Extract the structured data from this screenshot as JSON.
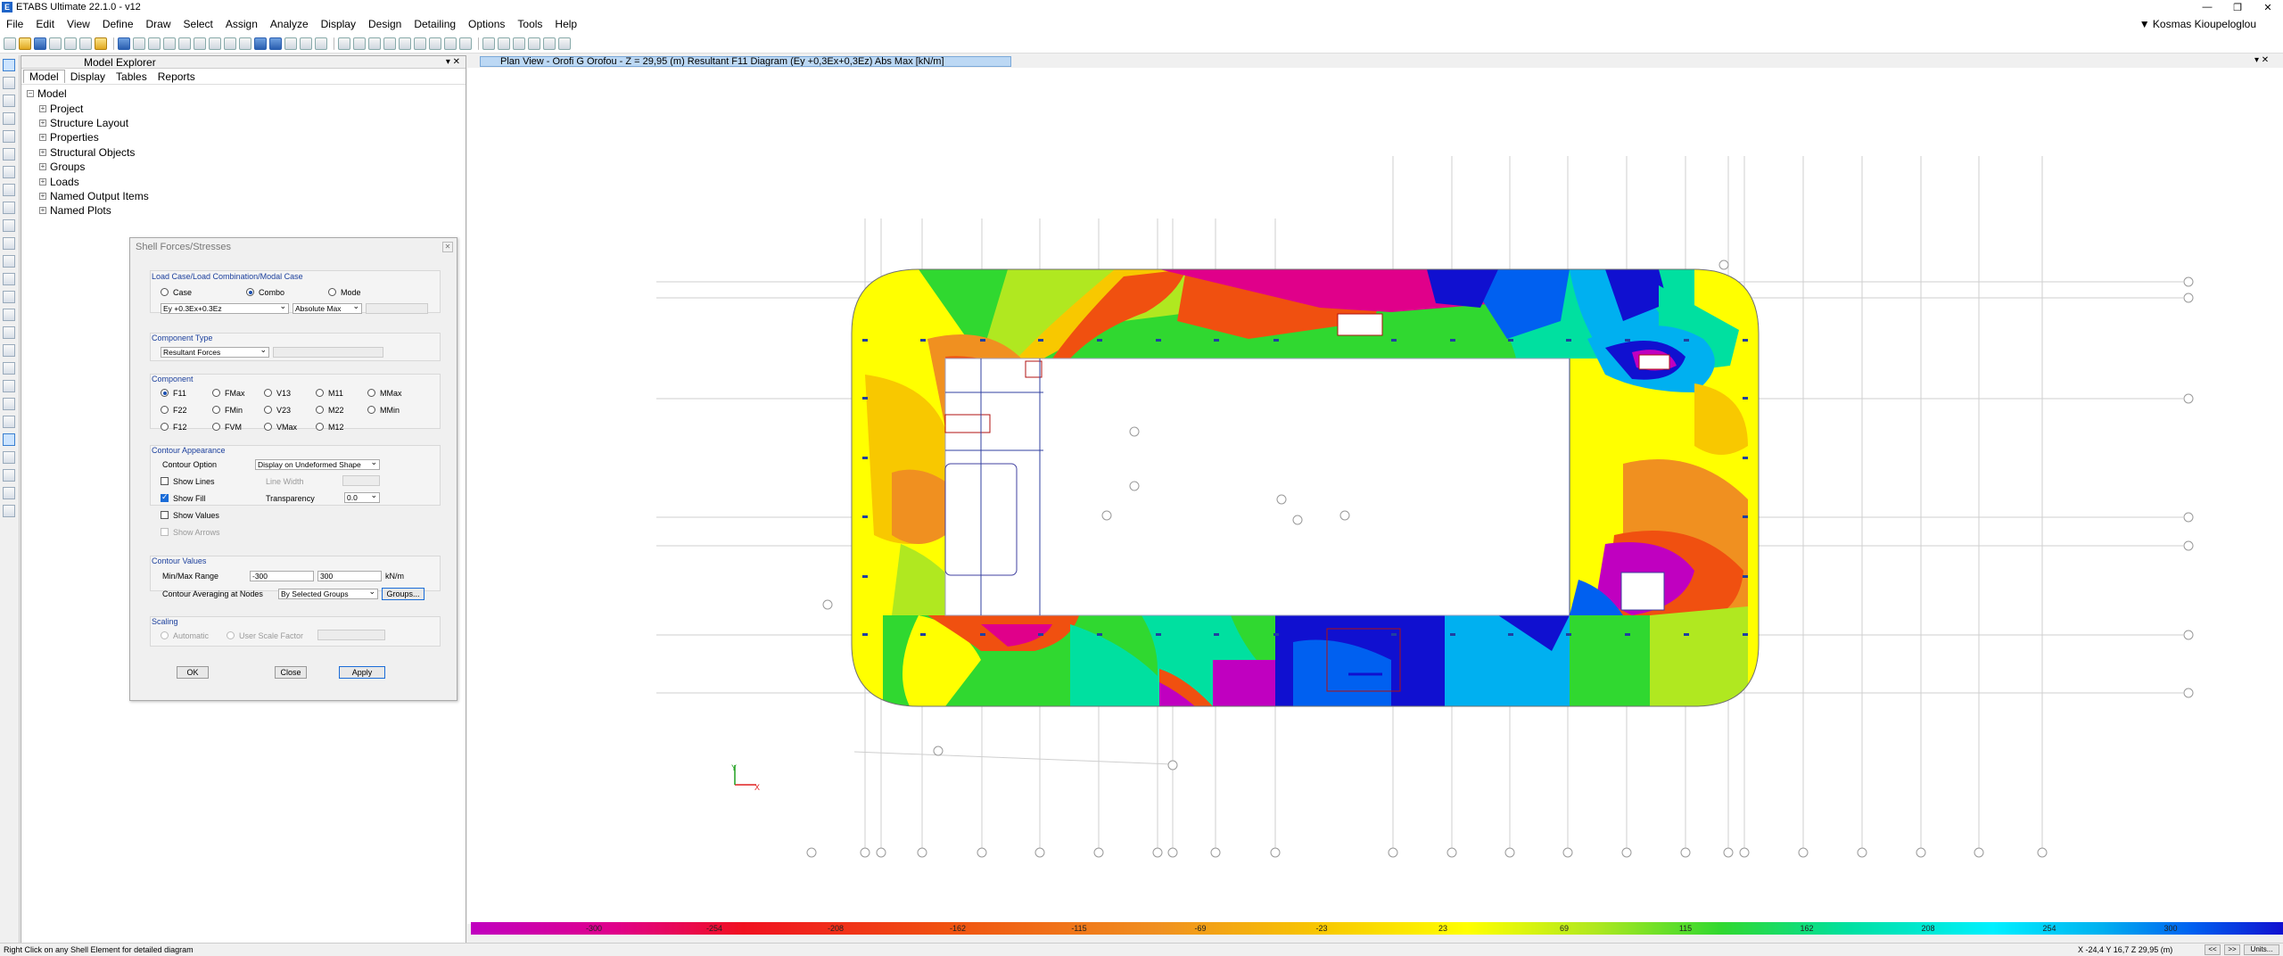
{
  "app": {
    "title": "ETABS Ultimate 22.1.0 - v12",
    "logo_letter": "E",
    "window_controls": [
      "—",
      "❐",
      "✕"
    ]
  },
  "menu": [
    "File",
    "Edit",
    "View",
    "Define",
    "Draw",
    "Select",
    "Assign",
    "Analyze",
    "Display",
    "Design",
    "Detailing",
    "Options",
    "Tools",
    "Help"
  ],
  "user": "▼  Kosmas Kioupeloglou",
  "explorer": {
    "title": "Model Explorer",
    "controls": "▾  ✕",
    "tabs": [
      "Model",
      "Display",
      "Tables",
      "Reports"
    ],
    "root": "Model",
    "items": [
      "Project",
      "Structure Layout",
      "Properties",
      "Structural Objects",
      "Groups",
      "Loads",
      "Named Output Items",
      "Named Plots"
    ]
  },
  "dialog": {
    "title": "Shell Forces/Stresses",
    "load_case_group": "Load Case/Load Combination/Modal Case",
    "case_label": "Case",
    "combo_label": "Combo",
    "mode_label": "Mode",
    "combo_value": "Ey +0.3Ex+0.3Ez",
    "envelope_value": "Absolute Max",
    "component_type_group": "Component Type",
    "component_type_value": "Resultant Forces",
    "component_group": "Component",
    "components": [
      "F11",
      "FMax",
      "V13",
      "M11",
      "MMax",
      "F22",
      "FMin",
      "V23",
      "M22",
      "MMin",
      "F12",
      "FVM",
      "VMax",
      "M12"
    ],
    "contour_appearance_group": "Contour Appearance",
    "contour_option_label": "Contour Option",
    "contour_option_value": "Display on Undeformed Shape",
    "show_lines": "Show Lines",
    "line_width": "Line Width",
    "show_fill": "Show Fill",
    "transparency_label": "Transparency",
    "transparency_value": "0.0",
    "show_values": "Show Values",
    "show_arrows": "Show Arrows",
    "contour_values_group": "Contour Values",
    "minmax_label": "Min/Max Range",
    "min_value": "-300",
    "max_value": "300",
    "units": "kN/m",
    "averaging_label": "Contour Averaging at Nodes",
    "averaging_value": "By Selected Groups",
    "groups_button": "Groups...",
    "scaling_group": "Scaling",
    "automatic": "Automatic",
    "user_scale": "User Scale Factor",
    "ok": "OK",
    "close": "Close",
    "apply": "Apply"
  },
  "view": {
    "tab_title": "Plan View - Orofi G Orofou - Z = 29,95 (m)   Resultant F11 Diagram   (Ey +0,3Ex+0,3Ez) Abs Max  [kN/m]",
    "controls": "▾  ✕",
    "axis_x": "X",
    "axis_y": "Y"
  },
  "legend": {
    "values": [
      "-300",
      "-254",
      "-208",
      "-162",
      "-115",
      "-69",
      "-23",
      "23",
      "69",
      "115",
      "162",
      "208",
      "254",
      "300"
    ],
    "colors": [
      "#c000c0",
      "#e0008a",
      "#f01020",
      "#f05010",
      "#f09020",
      "#f8c800",
      "#ffff00",
      "#b0e820",
      "#30d830",
      "#00e0a0",
      "#00f0ff",
      "#00b0f0",
      "#0060f0",
      "#1010d0"
    ]
  },
  "status": {
    "message": "Right Click on any Shell Element for detailed diagram",
    "coords": "X -24,4  Y 16,7  Z 29,95 (m)",
    "nav": [
      "<<",
      ">>"
    ],
    "units_button": "Units..."
  }
}
